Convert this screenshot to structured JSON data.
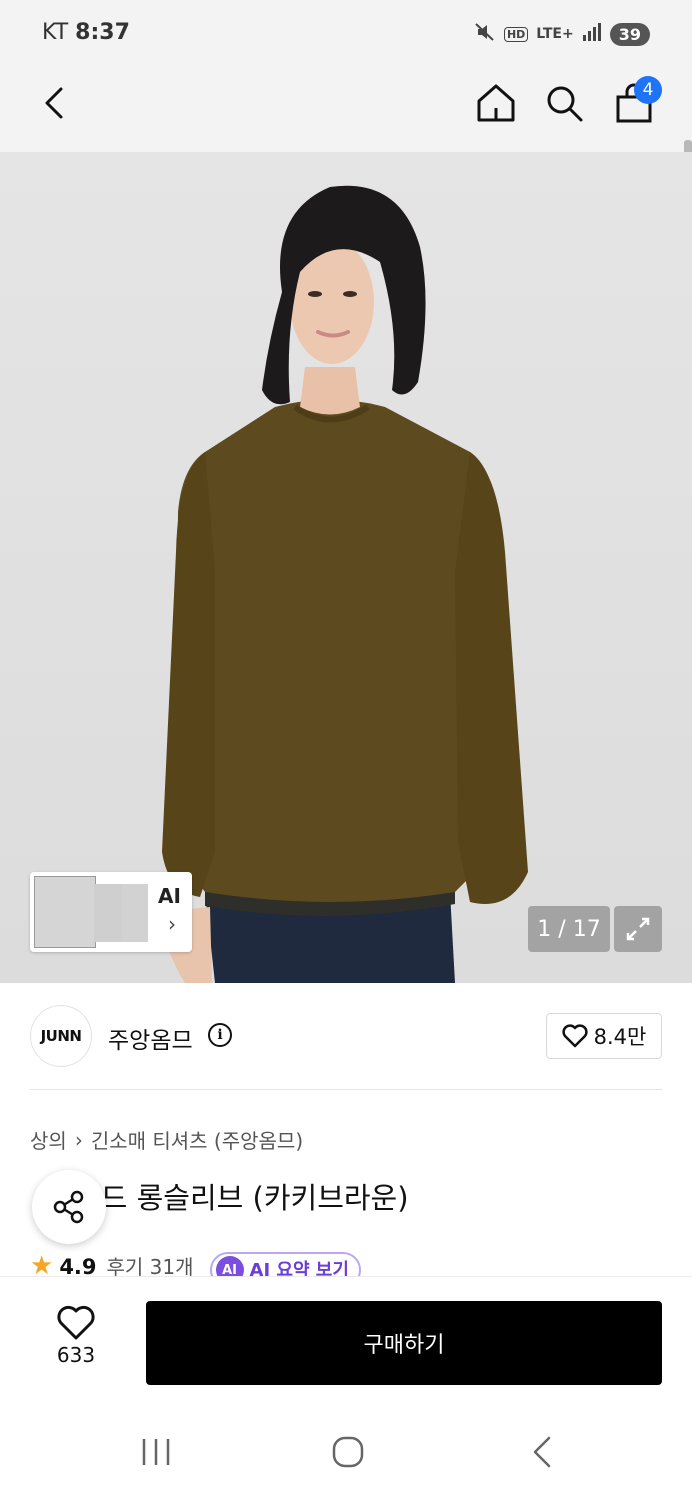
{
  "status_bar": {
    "carrier": "KT",
    "time": "8:37",
    "network": "LTE+",
    "hd": "HD",
    "battery": "39"
  },
  "header": {
    "cart_count": "4"
  },
  "gallery": {
    "ai_label": "AI",
    "page_counter": "1 / 17"
  },
  "brand": {
    "logo_text": "JUNN",
    "name": "주앙옴므",
    "likes": "8.4만"
  },
  "breadcrumb": {
    "level1": "상의",
    "level2": "긴소매 티셔츠 (주앙옴므)"
  },
  "product": {
    "title_visible": "커드 롱슬리브 (카키브라운)"
  },
  "rating": {
    "value": "4.9",
    "reviews": "후기 31개",
    "ai_badge": "AI",
    "ai_summary": "AI 요약 보기"
  },
  "bottom_bar": {
    "wish_count": "633",
    "buy_label": "구매하기"
  },
  "colors": {
    "accent_blue": "#1f74f5",
    "star": "#f5a623",
    "ai_purple": "#6b3fd6",
    "buy_button": "#000000",
    "sweater": "#5d4a1f"
  }
}
